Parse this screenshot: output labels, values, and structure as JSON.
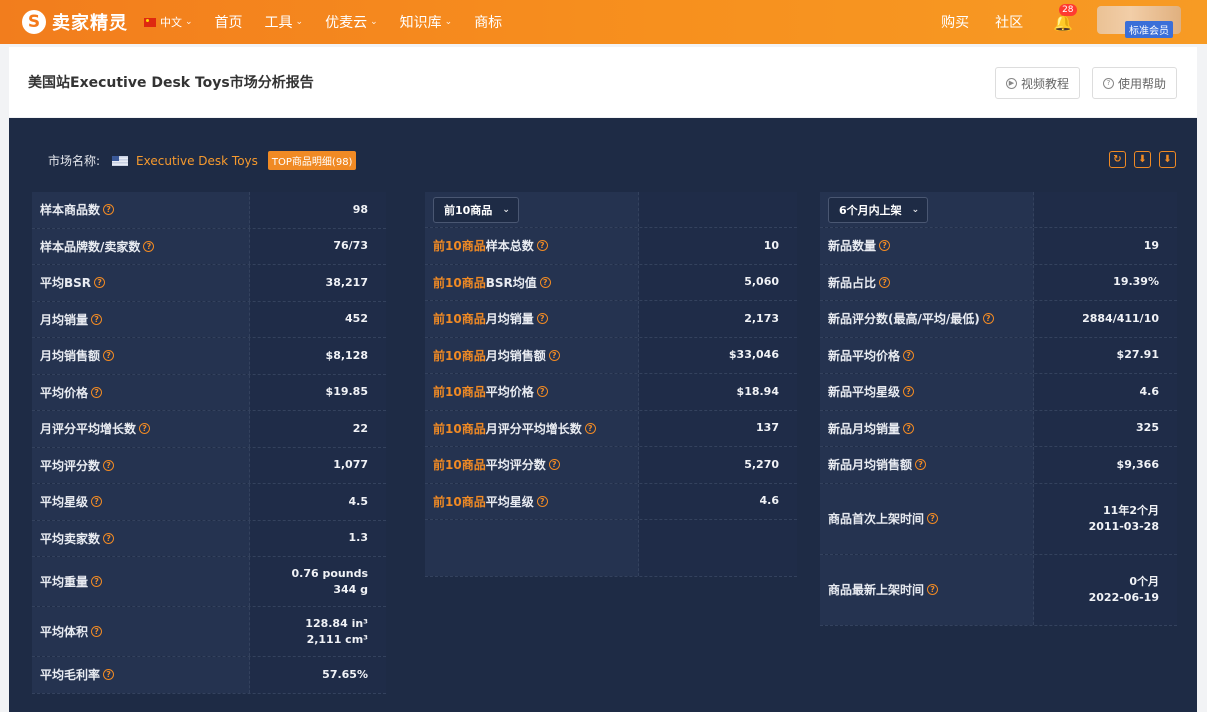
{
  "nav": {
    "logo_text": "卖家精灵",
    "lang": "中文",
    "items": [
      "首页",
      "工具",
      "优麦云",
      "知识库",
      "商标"
    ],
    "right_items": [
      "购买",
      "社区"
    ],
    "bell_count": "28",
    "member_badge": "标准会员"
  },
  "header": {
    "title": "美国站Executive Desk Toys市场分析报告",
    "video_btn": "视频教程",
    "help_btn": "使用帮助"
  },
  "market": {
    "label": "市场名称:",
    "name": "Executive Desk Toys",
    "top_badge": "TOP商品明细(98)"
  },
  "left_table": [
    {
      "label": "样本商品数",
      "value": "98"
    },
    {
      "label": "样本品牌数/卖家数",
      "value": "76/73"
    },
    {
      "label": "平均BSR",
      "value": "38,217"
    },
    {
      "label": "月均销量",
      "value": "452"
    },
    {
      "label": "月均销售额",
      "value": "$8,128"
    },
    {
      "label": "平均价格",
      "value": "$19.85"
    },
    {
      "label": "月评分平均增长数",
      "value": "22"
    },
    {
      "label": "平均评分数",
      "value": "1,077"
    },
    {
      "label": "平均星级",
      "value": "4.5"
    },
    {
      "label": "平均卖家数",
      "value": "1.3"
    },
    {
      "label": "平均重量",
      "value": "0.76 pounds",
      "value2": "344 g"
    },
    {
      "label": "平均体积",
      "value": "128.84 in³",
      "value2": "2,111 cm³"
    },
    {
      "label": "平均毛利率",
      "value": "57.65%"
    }
  ],
  "mid_table": {
    "dropdown": "前10商品",
    "prefix": "前10商品",
    "rows": [
      {
        "label": "样本总数",
        "value": "10"
      },
      {
        "label": "BSR均值",
        "value": "5,060"
      },
      {
        "label": "月均销量",
        "value": "2,173"
      },
      {
        "label": "月均销售额",
        "value": "$33,046"
      },
      {
        "label": "平均价格",
        "value": "$18.94"
      },
      {
        "label": "月评分平均增长数",
        "value": "137"
      },
      {
        "label": "平均评分数",
        "value": "5,270"
      },
      {
        "label": "平均星级",
        "value": "4.6"
      }
    ]
  },
  "right_table": {
    "dropdown": "6个月内上架",
    "rows": [
      {
        "label": "新品数量",
        "value": "19"
      },
      {
        "label": "新品占比",
        "value": "19.39%"
      },
      {
        "label": "新品评分数(最高/平均/最低)",
        "value": "2884/411/10"
      },
      {
        "label": "新品平均价格",
        "value": "$27.91"
      },
      {
        "label": "新品平均星级",
        "value": "4.6"
      },
      {
        "label": "新品月均销量",
        "value": "325"
      },
      {
        "label": "新品月均销售额",
        "value": "$9,366"
      },
      {
        "label": "商品首次上架时间",
        "value": "11年2个月",
        "value2": "2011-03-28"
      },
      {
        "label": "商品最新上架时间",
        "value": "0个月",
        "value2": "2022-06-19"
      }
    ]
  }
}
